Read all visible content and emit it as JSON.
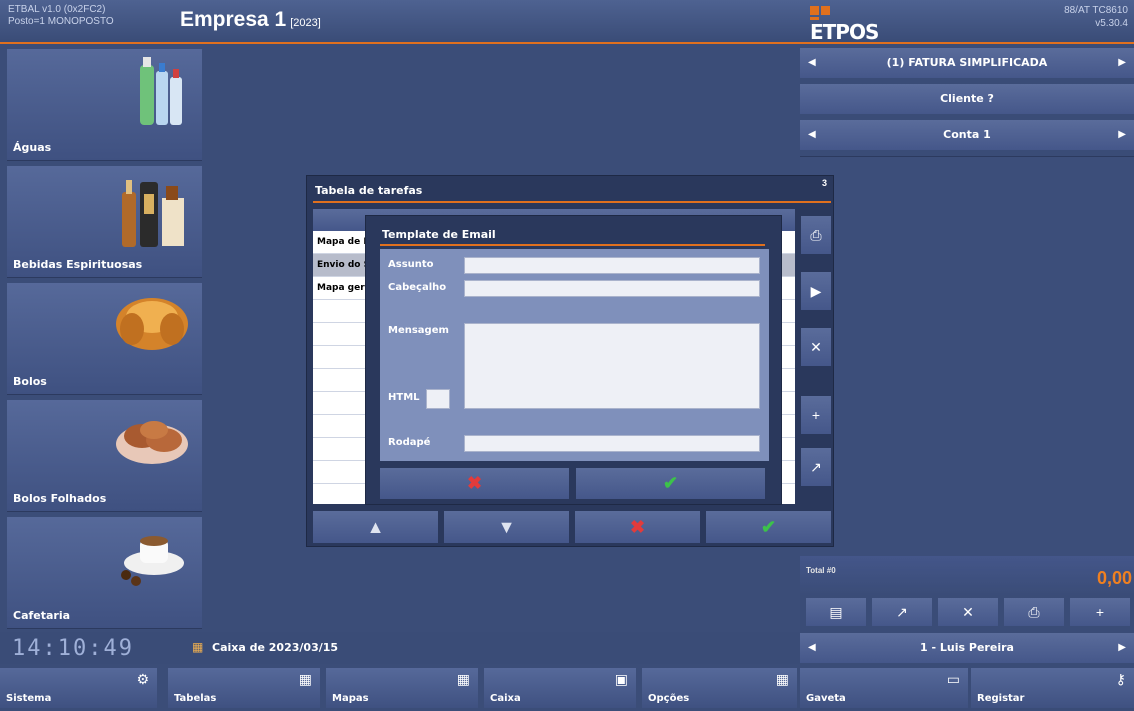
{
  "header": {
    "app_version": "ETBAL v1.0 (0x2FC2)",
    "post": "Posto=1 MONOPOSTO",
    "company": "Empresa 1",
    "year": "[2023]",
    "logo_text": "ETPOS",
    "terminal": "88/AT TC8610",
    "version": "v5.30.4"
  },
  "categories": [
    {
      "label": "Águas",
      "icon": "water-bottles-icon"
    },
    {
      "label": "Bebidas Espirituosas",
      "icon": "liquor-bottles-icon"
    },
    {
      "label": "Bolos",
      "icon": "croissant-icon"
    },
    {
      "label": "Bolos Folhados",
      "icon": "pastries-icon"
    },
    {
      "label": "Cafetaria",
      "icon": "coffee-cup-icon"
    }
  ],
  "right_panel": {
    "doc_type": "(1) FATURA SIMPLIFICADA",
    "client": "Cliente ?",
    "account": "Conta 1",
    "total_label": "Total #0",
    "total_value": "0,00",
    "operator": "1 - Luis Pereira"
  },
  "status": {
    "clock": "14:10:49",
    "caixa": "Caixa de 2023/03/15"
  },
  "bottom_menu": [
    {
      "label": "Sistema",
      "icon": "gears-icon"
    },
    {
      "label": "Tabelas",
      "icon": "tables-icon"
    },
    {
      "label": "Mapas",
      "icon": "maps-icon"
    },
    {
      "label": "Caixa",
      "icon": "cash-register-icon"
    },
    {
      "label": "Opções",
      "icon": "grid-icon"
    },
    {
      "label": "Gaveta",
      "icon": "drawer-icon"
    },
    {
      "label": "Registar",
      "icon": "register-key-icon"
    }
  ],
  "task_dialog": {
    "title": "Tabela de tarefas",
    "count": "3",
    "rows": [
      "Mapa de IVA",
      "Envio do SAF",
      "Mapa geral ("
    ]
  },
  "email_dialog": {
    "title": "Template de Email",
    "assunto": "Assunto",
    "cabecalho": "Cabeçalho",
    "mensagem": "Mensagem",
    "html": "HTML",
    "rodape": "Rodapé"
  },
  "colors": {
    "accent": "#e0701e",
    "background": "#3b4d78",
    "cancel": "#e23b3b",
    "confirm": "#3cc24a"
  }
}
